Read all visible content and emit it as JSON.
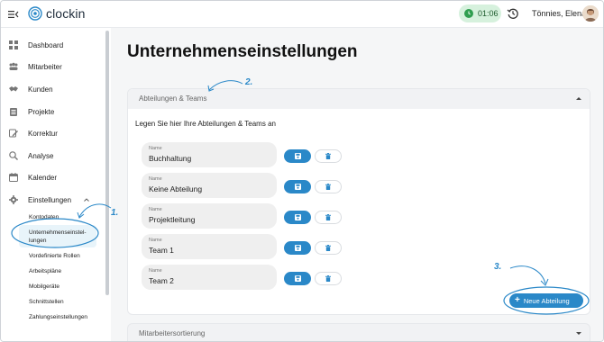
{
  "header": {
    "app_name": "clockin",
    "timer": "01:06",
    "user_name": "Tönnies, Elena"
  },
  "sidebar": {
    "items": [
      {
        "label": "Dashboard",
        "icon": "dashboard-icon"
      },
      {
        "label": "Mitarbeiter",
        "icon": "people-icon"
      },
      {
        "label": "Kunden",
        "icon": "handshake-icon"
      },
      {
        "label": "Projekte",
        "icon": "clipboard-icon"
      },
      {
        "label": "Korrektur",
        "icon": "edit-icon"
      },
      {
        "label": "Analyse",
        "icon": "search-chart-icon"
      },
      {
        "label": "Kalender",
        "icon": "calendar-icon"
      },
      {
        "label": "Einstellungen",
        "icon": "gear-icon"
      }
    ],
    "sub_items": [
      {
        "label": "Kontodaten"
      },
      {
        "label_line1": "Unternehmenseinstel-",
        "label_line2": "lungen"
      },
      {
        "label": "Vordefinierte Rollen"
      },
      {
        "label": "Arbeitspläne"
      },
      {
        "label": "Mobilgeräte"
      },
      {
        "label": "Schnittstellen"
      },
      {
        "label": "Zahlungseinstellungen"
      }
    ]
  },
  "main": {
    "title": "Unternehmenseinstellungen",
    "section_teams": {
      "title": "Abteilungen & Teams",
      "description": "Legen Sie hier Ihre Abteilungen & Teams an",
      "field_label": "Name",
      "rows": [
        {
          "name": "Buchhaltung"
        },
        {
          "name": "Keine Abteilung"
        },
        {
          "name": "Projektleitung"
        },
        {
          "name": "Team 1"
        },
        {
          "name": "Team 2"
        }
      ],
      "add_button": "Neue Abteilung"
    },
    "section_next": {
      "title": "Mitarbeitersortierung"
    }
  },
  "annotations": {
    "step1": "1.",
    "step2": "2.",
    "step3": "3."
  },
  "colors": {
    "accent": "#2a88c8",
    "timer_bg": "#d6f1dd",
    "annotation": "#2a88c8"
  }
}
